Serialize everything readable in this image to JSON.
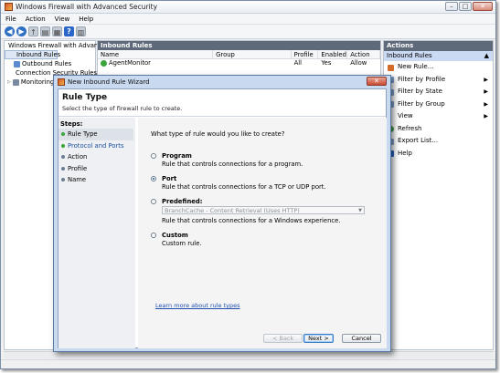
{
  "window": {
    "title": "Windows Firewall with Advanced Security",
    "controls": [
      "–",
      "□",
      "✕"
    ]
  },
  "menu": [
    "File",
    "Action",
    "View",
    "Help"
  ],
  "toolbar": {
    "icons": [
      "back-icon",
      "forward-icon",
      "up-icon",
      "show-hide-tree-icon",
      "properties-icon",
      "help-icon",
      "show-hide-action-pane-icon"
    ]
  },
  "tree": {
    "root": "Windows Firewall with Advance",
    "items": [
      "Inbound Rules",
      "Outbound Rules",
      "Connection Security Rules",
      "Monitoring"
    ]
  },
  "center": {
    "title": "Inbound Rules",
    "columns": [
      "Name",
      "Group",
      "Profile",
      "Enabled",
      "Action"
    ],
    "rows": [
      {
        "name": "AgentMonitor",
        "group": "",
        "profile": "All",
        "enabled": "Yes",
        "action": "Allow"
      }
    ]
  },
  "actions": {
    "title": "Actions",
    "section": "Inbound Rules",
    "items": [
      {
        "label": "New Rule...",
        "submenu": false,
        "icon": "new-rule-icon"
      },
      {
        "label": "Filter by Profile",
        "submenu": true,
        "icon": "filter-icon"
      },
      {
        "label": "Filter by State",
        "submenu": true,
        "icon": "filter-icon"
      },
      {
        "label": "Filter by Group",
        "submenu": true,
        "icon": "filter-icon"
      },
      {
        "label": "View",
        "submenu": true,
        "icon": ""
      },
      {
        "label": "Refresh",
        "submenu": false,
        "icon": "refresh-icon"
      },
      {
        "label": "Export List...",
        "submenu": false,
        "icon": "export-icon"
      },
      {
        "label": "Help",
        "submenu": false,
        "icon": "help-icon"
      }
    ]
  },
  "wizard": {
    "title": "New Inbound Rule Wizard",
    "close": "✕",
    "heading": "Rule Type",
    "subheading": "Select the type of firewall rule to create.",
    "steps_label": "Steps:",
    "steps": [
      "Rule Type",
      "Protocol and Ports",
      "Action",
      "Profile",
      "Name"
    ],
    "question": "What type of rule would you like to create?",
    "options": [
      {
        "label": "Program",
        "desc": "Rule that controls connections for a program."
      },
      {
        "label": "Port",
        "desc": "Rule that controls connections for a TCP or UDP port."
      },
      {
        "label": "Predefined:",
        "desc": "Rule that controls connections for a Windows experience."
      },
      {
        "label": "Custom",
        "desc": "Custom rule."
      }
    ],
    "selected_option": "Port",
    "predefined_select": "BranchCache - Content Retrieval (Uses HTTP)",
    "learn_more": "Learn more about rule types",
    "buttons": {
      "back": "< Back",
      "next": "Next >",
      "cancel": "Cancel"
    }
  },
  "colors": {
    "accent_blue": "#1f4fa0",
    "panel_header": "#5e6a7a",
    "selected_section": "#c9daf2"
  }
}
